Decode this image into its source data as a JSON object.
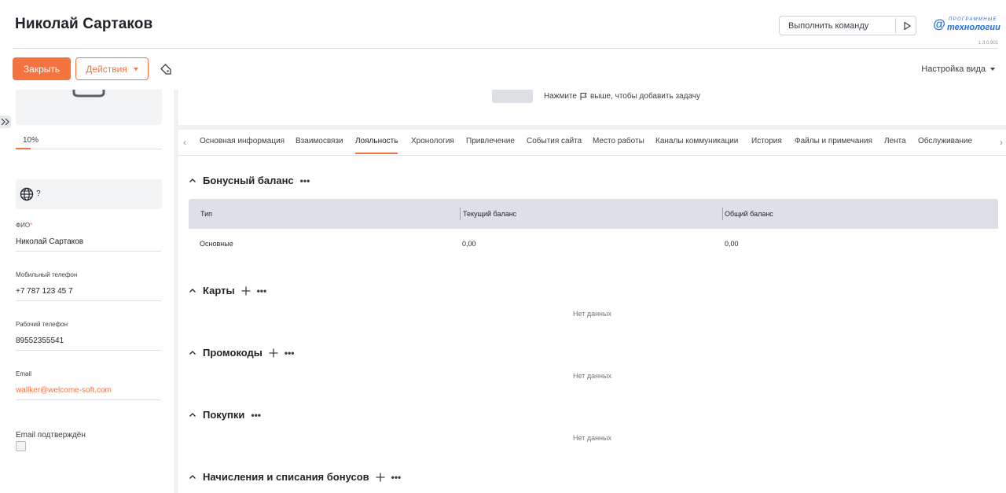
{
  "header": {
    "title": "Николай Сартаков",
    "command_placeholder": "Выполнить команду",
    "logo_top": "ПРОГРАММНЫЕ",
    "logo_bottom": "технологии",
    "version": "1.3.0.901"
  },
  "actions": {
    "close_label": "Закрыть",
    "actions_label": "Действия",
    "view_settings_label": "Настройка вида"
  },
  "sidebar": {
    "progress_label": "10%",
    "progress_value": 0.1,
    "language_unknown": "?",
    "fields": [
      {
        "label": "ФИО",
        "required": "*",
        "value": "Николай Сартаков"
      },
      {
        "label": "Мобильный телефон",
        "value": "+7 787 123 45 7"
      },
      {
        "label": "Рабочий телефон",
        "value": "89552355541"
      },
      {
        "label": "Email",
        "value": "wallker@welcome-soft.com"
      }
    ],
    "email_confirmed_label": "Email подтверждён",
    "email_confirmed": false
  },
  "task_panel": {
    "hint_before": "Нажмите",
    "hint_after": "выше, чтобы добавить задачу"
  },
  "tabs": [
    "Основная информация",
    "Взаимосвязи",
    "Лояльность",
    "Хронология",
    "Привлечение",
    "События сайта",
    "Место работы",
    "Каналы коммуникации",
    "История",
    "Файлы и примечания",
    "Лента",
    "Обслуживание"
  ],
  "active_tab": "Лояльность",
  "bonus": {
    "title": "Бонусный баланс",
    "columns": [
      "Тип",
      "Текущий баланс",
      "Общий баланс"
    ],
    "rows": [
      [
        "Основные",
        "0,00",
        "0,00"
      ]
    ]
  },
  "sections": {
    "cards_title": "Карты",
    "promo_title": "Промокоды",
    "purchases_title": "Покупки",
    "accruals_title": "Начисления и списания бонусов",
    "no_data": "Нет данных"
  },
  "colors": {
    "accent": "#f3743f",
    "brand_blue": "#1e6fd6"
  }
}
